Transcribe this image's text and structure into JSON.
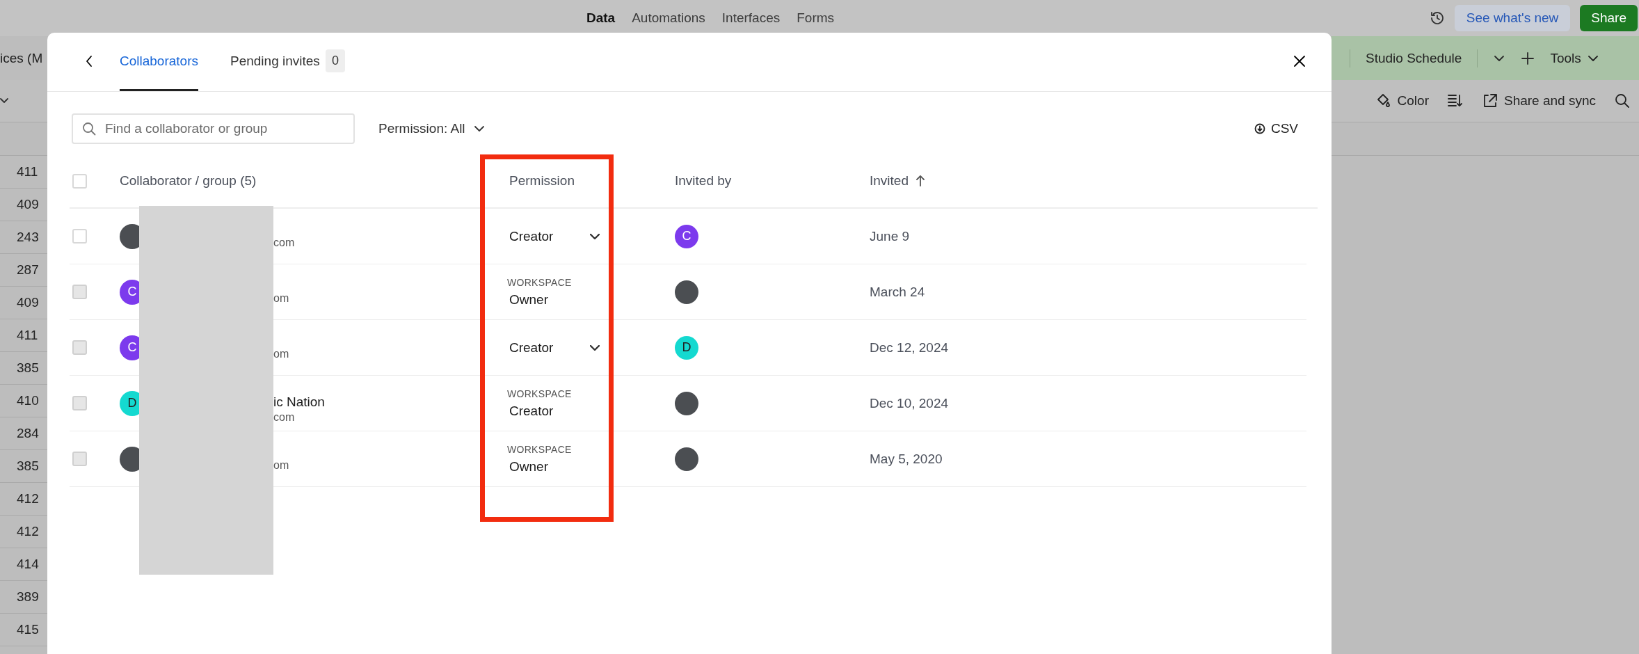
{
  "app_bar": {
    "nav": [
      {
        "label": "Data",
        "selected": true
      },
      {
        "label": "Automations",
        "selected": false
      },
      {
        "label": "Interfaces",
        "selected": false
      },
      {
        "label": "Forms",
        "selected": false
      }
    ],
    "whats_new": "See what's new",
    "share": "Share"
  },
  "table_bar": {
    "table_tab": "ices (M",
    "view_tab": "Studio Schedule",
    "tools": "Tools"
  },
  "view_bar": {
    "actions": [
      {
        "kind": "color",
        "label": "Color"
      },
      {
        "kind": "sort"
      },
      {
        "kind": "share",
        "label": "Share and sync"
      },
      {
        "kind": "search"
      }
    ]
  },
  "row_numbers": [
    "411",
    "409",
    "243",
    "287",
    "409",
    "411",
    "385",
    "410",
    "284",
    "385",
    "412",
    "412",
    "414",
    "389",
    "415"
  ],
  "dialog": {
    "tabs": [
      {
        "label": "Collaborators",
        "selected": true
      },
      {
        "label": "Pending invites",
        "count": "0",
        "selected": false
      }
    ],
    "search": {
      "placeholder": "Find a collaborator or group"
    },
    "filter": "Permission: All",
    "export": "CSV",
    "select_all": {
      "checked": false
    },
    "columns": [
      "Collaborator / group (5)",
      "Permission",
      "Invited by",
      "Invited"
    ],
    "rows": [
      {
        "checked": false,
        "disabled": false,
        "avatar": {
          "kind": "photo"
        },
        "email": "com",
        "permission": {
          "kind": "dropdown",
          "role": "Creator"
        },
        "invited_by": {
          "kind": "letter",
          "letter": "C",
          "color": "#7c3aed"
        },
        "invited": "June 9"
      },
      {
        "checked": false,
        "disabled": true,
        "avatar": {
          "kind": "letter",
          "letter": "C",
          "color": "#7c3aed"
        },
        "email": "om",
        "permission": {
          "kind": "workspace",
          "label": "WORKSPACE",
          "role": "Owner"
        },
        "invited_by": {
          "kind": "photo"
        },
        "invited": "March 24"
      },
      {
        "checked": false,
        "disabled": true,
        "avatar": {
          "kind": "letter",
          "letter": "C",
          "color": "#7c3aed"
        },
        "email": "om",
        "permission": {
          "kind": "dropdown",
          "role": "Creator"
        },
        "invited_by": {
          "kind": "letter",
          "letter": "D",
          "color": "#14d9d0"
        },
        "invited": "Dec 12, 2024"
      },
      {
        "checked": false,
        "disabled": true,
        "avatar": {
          "kind": "letter",
          "letter": "D",
          "color": "#14d9d0"
        },
        "name": "ic Nation",
        "email": "com",
        "permission": {
          "kind": "workspace",
          "label": "WORKSPACE",
          "role": "Creator"
        },
        "invited_by": {
          "kind": "photo"
        },
        "invited": "Dec 10, 2024"
      },
      {
        "checked": false,
        "disabled": true,
        "avatar": {
          "kind": "photo"
        },
        "email": "om",
        "permission": {
          "kind": "workspace",
          "label": "WORKSPACE",
          "role": "Owner"
        },
        "invited_by": {
          "kind": "photo"
        },
        "invited": "May 5, 2020"
      }
    ]
  }
}
